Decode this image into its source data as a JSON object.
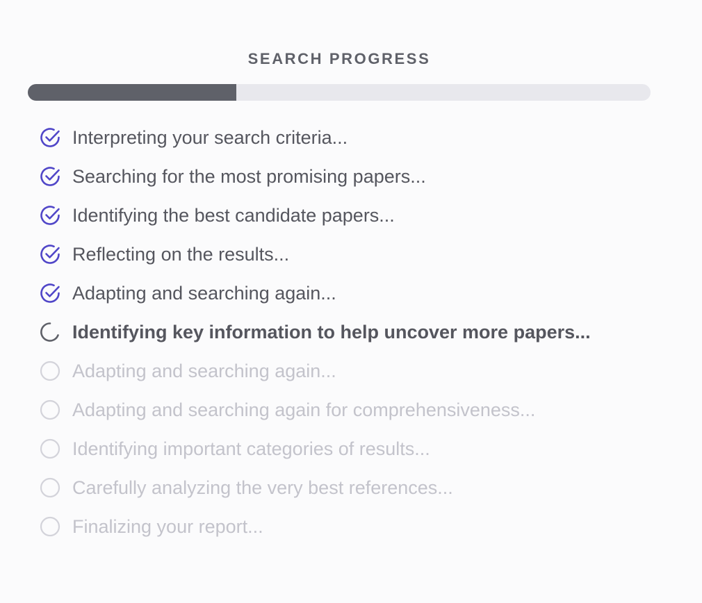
{
  "header": {
    "title": "SEARCH PROGRESS"
  },
  "progress": {
    "fraction": 0.335,
    "fill_color": "#5f6169",
    "track_color": "#e8e8ed"
  },
  "colors": {
    "check_accent": "#5046c8",
    "pending_circle": "#d3d3da"
  },
  "steps": [
    {
      "label": "Interpreting your search criteria...",
      "status": "done",
      "icon": "check-circle-icon"
    },
    {
      "label": "Searching for the most promising papers...",
      "status": "done",
      "icon": "check-circle-icon"
    },
    {
      "label": "Identifying the best candidate papers...",
      "status": "done",
      "icon": "check-circle-icon"
    },
    {
      "label": "Reflecting on the results...",
      "status": "done",
      "icon": "check-circle-icon"
    },
    {
      "label": "Adapting and searching again...",
      "status": "done",
      "icon": "check-circle-icon"
    },
    {
      "label": "Identifying key information to help uncover more papers...",
      "status": "active",
      "icon": "spinner-icon"
    },
    {
      "label": "Adapting and searching again...",
      "status": "pending",
      "icon": "empty-circle-icon"
    },
    {
      "label": "Adapting and searching again for comprehensiveness...",
      "status": "pending",
      "icon": "empty-circle-icon"
    },
    {
      "label": "Identifying important categories of results...",
      "status": "pending",
      "icon": "empty-circle-icon"
    },
    {
      "label": "Carefully analyzing the very best references...",
      "status": "pending",
      "icon": "empty-circle-icon"
    },
    {
      "label": "Finalizing your report...",
      "status": "pending",
      "icon": "empty-circle-icon"
    }
  ]
}
